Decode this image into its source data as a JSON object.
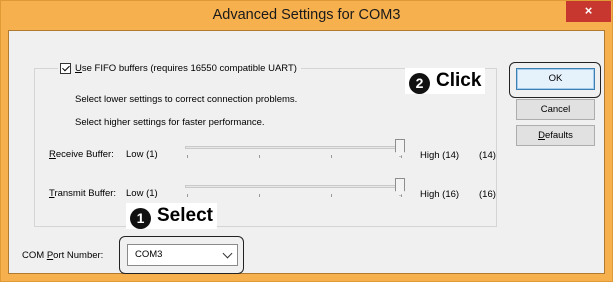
{
  "window": {
    "title": "Advanced Settings for COM3",
    "close_glyph": "×"
  },
  "fifo": {
    "checked": true,
    "label_underlined": "U",
    "label_rest": "se FIFO buffers (requires 16550 compatible UART)"
  },
  "hints": {
    "lower": "Select lower settings to correct connection problems.",
    "higher": "Select higher settings for faster performance."
  },
  "receive": {
    "label_underlined": "R",
    "label_rest": "eceive Buffer:",
    "low": "Low (1)",
    "high": "High (14)",
    "value": "(14)",
    "level": 1.0
  },
  "transmit": {
    "label_underlined": "T",
    "label_rest": "ransmit Buffer:",
    "low": "Low (1)",
    "high": "High (16)",
    "value": "(16)",
    "level": 1.0
  },
  "com_port": {
    "label_before": "COM ",
    "label_underlined": "P",
    "label_after": "ort Number:",
    "selected": "COM3"
  },
  "buttons": {
    "ok": "OK",
    "cancel": "Cancel",
    "defaults_underlined": "D",
    "defaults_rest": "efaults"
  },
  "callouts": {
    "click_number": "❷",
    "click_text": "Click",
    "select_number": "❶",
    "select_text": "Select"
  },
  "colors": {
    "frame": "#f6b04e",
    "close_button": "#c7372f",
    "client": "#f0f0f0",
    "ok_border": "#3c7fb1"
  }
}
